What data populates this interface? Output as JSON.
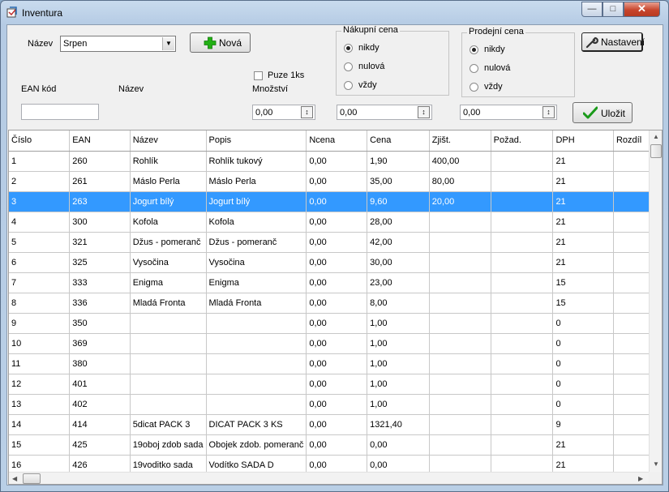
{
  "window": {
    "title": "Inventura",
    "min_glyph": "—",
    "max_glyph": "□",
    "close_glyph": "✕"
  },
  "filter": {
    "nazev_label": "Název",
    "nazev_value": "Srpen",
    "nova_label": "Nová",
    "ean_label": "EAN kód",
    "nazev2_label": "Název",
    "puze_label": "Puze 1ks",
    "mnozstvi_label": "Množství",
    "mnozstvi_value": "0,00",
    "nakup_value": "0,00",
    "prodej_value": "0,00",
    "nastaveni_label": "Nastavení",
    "ulozit_label": "Uložit"
  },
  "nakupni": {
    "title": "Nákupní cena",
    "options": [
      "nikdy",
      "nulová",
      "vždy"
    ],
    "selected": 0
  },
  "prodejni": {
    "title": "Prodejní cena",
    "options": [
      "nikdy",
      "nulová",
      "vždy"
    ],
    "selected": 0
  },
  "table": {
    "columns": [
      "Číslo",
      "EAN",
      "Název",
      "Popis",
      "Ncena",
      "Cena",
      "Zjišt.",
      "Požad.",
      "DPH",
      "Rozdíl"
    ],
    "selected_row": 2,
    "rows": [
      [
        "1",
        "260",
        "Rohlík",
        "Rohlík tukový",
        "0,00",
        "1,90",
        "400,00",
        "",
        "21",
        ""
      ],
      [
        "2",
        "261",
        "Máslo Perla",
        "Máslo Perla",
        "0,00",
        "35,00",
        "80,00",
        "",
        "21",
        ""
      ],
      [
        "3",
        "263",
        "Jogurt bílý",
        "Jogurt bílý",
        "0,00",
        "9,60",
        "20,00",
        "",
        "21",
        ""
      ],
      [
        "4",
        "300",
        "Kofola",
        "Kofola",
        "0,00",
        "28,00",
        "",
        "",
        "21",
        ""
      ],
      [
        "5",
        "321",
        "Džus - pomeranč",
        "Džus - pomeranč",
        "0,00",
        "42,00",
        "",
        "",
        "21",
        ""
      ],
      [
        "6",
        "325",
        "Vysočina",
        "Vysočina",
        "0,00",
        "30,00",
        "",
        "",
        "21",
        ""
      ],
      [
        "7",
        "333",
        "Enigma",
        "Enigma",
        "0,00",
        "23,00",
        "",
        "",
        "15",
        ""
      ],
      [
        "8",
        "336",
        "Mladá Fronta",
        "Mladá Fronta",
        "0,00",
        "8,00",
        "",
        "",
        "15",
        ""
      ],
      [
        "9",
        "350",
        "",
        "",
        "0,00",
        "1,00",
        "",
        "",
        "0",
        ""
      ],
      [
        "10",
        "369",
        "",
        "",
        "0,00",
        "1,00",
        "",
        "",
        "0",
        ""
      ],
      [
        "11",
        "380",
        "",
        "",
        "0,00",
        "1,00",
        "",
        "",
        "0",
        ""
      ],
      [
        "12",
        "401",
        "",
        "",
        "0,00",
        "1,00",
        "",
        "",
        "0",
        ""
      ],
      [
        "13",
        "402",
        "",
        "",
        "0,00",
        "1,00",
        "",
        "",
        "0",
        ""
      ],
      [
        "14",
        "414",
        " 5dicat PACK 3",
        "DICAT PACK 3 KS",
        "0,00",
        "1321,40",
        "",
        "",
        "9",
        ""
      ],
      [
        "15",
        "425",
        "19oboj zdob sada",
        "Obojek zdob. pomeranč",
        "0,00",
        "0,00",
        "",
        "",
        "21",
        ""
      ],
      [
        "16",
        "426",
        "19voditko sada",
        "Vodítko SADA  D",
        "0,00",
        "0,00",
        "",
        "",
        "21",
        ""
      ]
    ]
  },
  "colors": {
    "selection": "#3399ff",
    "plus": "#22b014",
    "check": "#1a9a1a"
  }
}
